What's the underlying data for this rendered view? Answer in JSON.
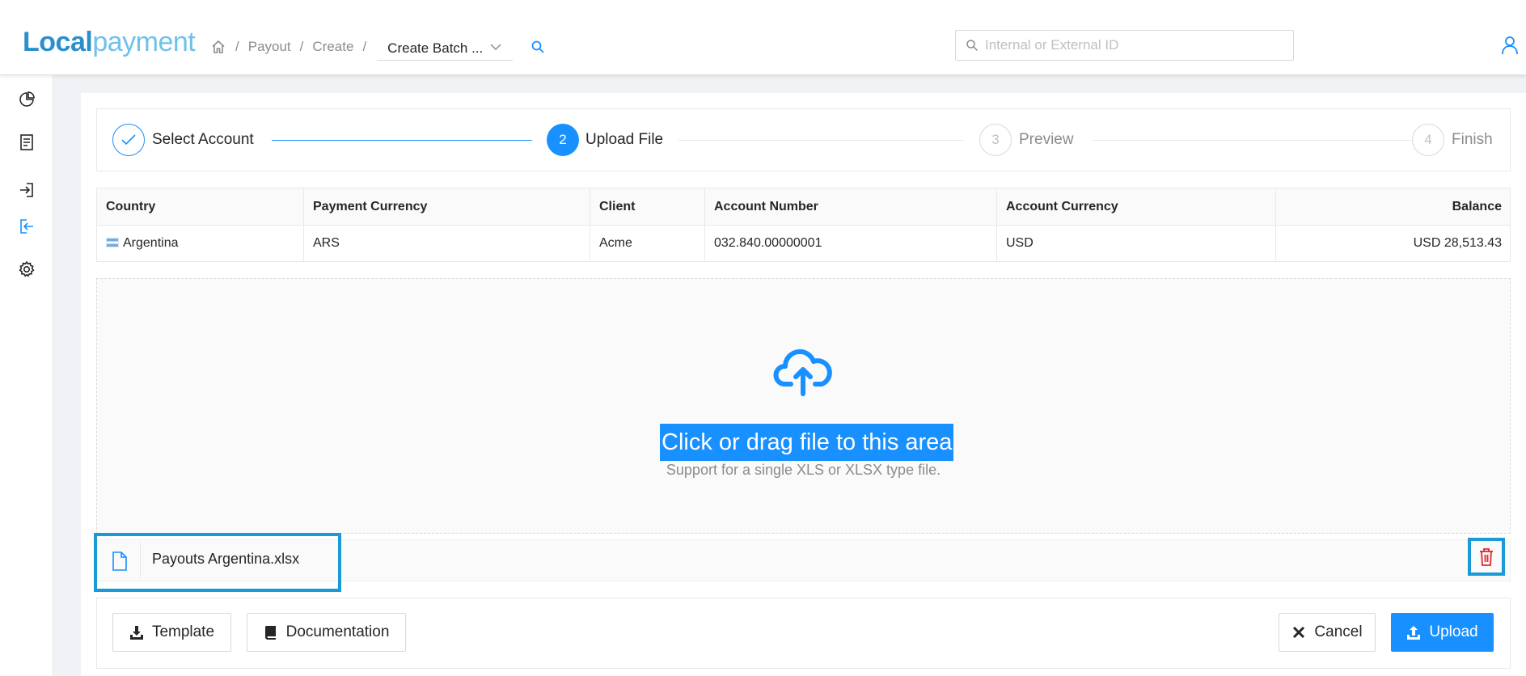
{
  "header": {
    "logo_part1": "Local",
    "logo_part2": "payment",
    "breadcrumb": [
      "Payout",
      "Create"
    ],
    "breadcrumb_select": "Create Batch ...",
    "search_placeholder": "Internal or External ID"
  },
  "sidebar": {
    "items": [
      "dashboard-icon",
      "ledger-icon",
      "payin-icon",
      "payout-icon",
      "settings-icon"
    ],
    "active_index": 3
  },
  "steps": [
    {
      "number": "1",
      "label": "Select Account",
      "status": "finished"
    },
    {
      "number": "2",
      "label": "Upload File",
      "status": "active"
    },
    {
      "number": "3",
      "label": "Preview",
      "status": "waiting"
    },
    {
      "number": "4",
      "label": "Finish",
      "status": "waiting"
    }
  ],
  "account_table": {
    "columns": [
      "Country",
      "Payment Currency",
      "Client",
      "Account Number",
      "Account Currency",
      "Balance"
    ],
    "row": [
      "Argentina",
      "ARS",
      "Acme",
      "032.840.00000001",
      "USD",
      "USD 28,513.43"
    ]
  },
  "dropzone": {
    "title": "Click or drag file to this area",
    "hint": "Support for a single XLS or XLSX type file."
  },
  "file": {
    "name": "Payouts Argentina.xlsx"
  },
  "actions": {
    "template": "Template",
    "documentation": "Documentation",
    "cancel": "Cancel",
    "upload": "Upload"
  },
  "colors": {
    "primary": "#1890ff",
    "brand_dark": "#2c8fc9",
    "brand_light": "#6ec1ea",
    "danger": "#e0282e",
    "highlight_box": "#1a9bd7"
  }
}
